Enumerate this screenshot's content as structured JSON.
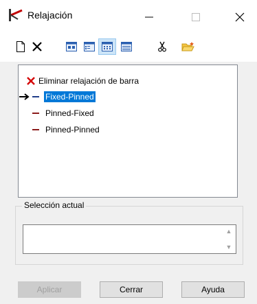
{
  "window": {
    "title": "Relajación",
    "icons": {
      "app": "beam-release-icon",
      "minimize": "minimize-icon",
      "maximize": "maximize-icon",
      "close": "close-icon"
    }
  },
  "toolbar": {
    "buttons": [
      {
        "name": "new-icon"
      },
      {
        "name": "delete-icon"
      },
      {
        "name": "large-icons-view-icon"
      },
      {
        "name": "small-icons-view-icon"
      },
      {
        "name": "list-view-icon",
        "active": true
      },
      {
        "name": "details-view-icon"
      },
      {
        "name": "cut-icon"
      },
      {
        "name": "open-folder-icon"
      }
    ]
  },
  "list": {
    "items": [
      {
        "label": "Eliminar relajación de barra",
        "icon": "red-x-icon"
      },
      {
        "label": "Fixed-Pinned",
        "icon": "dash-icon",
        "selected": true,
        "current": true
      },
      {
        "label": "Pinned-Fixed",
        "icon": "dash-icon"
      },
      {
        "label": "Pinned-Pinned",
        "icon": "dash-icon"
      }
    ]
  },
  "selection": {
    "legend": "Selección actual",
    "value": ""
  },
  "buttons": {
    "apply": "Aplicar",
    "close": "Cerrar",
    "help": "Ayuda"
  },
  "colors": {
    "selection": "#0078d7",
    "dash": "#8b1a1a",
    "delete_x": "#d40000"
  }
}
